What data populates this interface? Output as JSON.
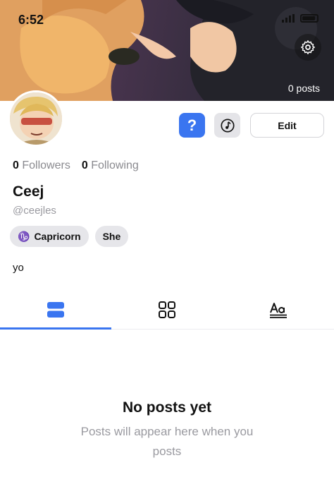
{
  "status_bar": {
    "time": "6:52"
  },
  "banner": {
    "posts_label": "0 posts"
  },
  "actions": {
    "help_label": "?",
    "edit_label": "Edit"
  },
  "stats": {
    "followers_count": "0",
    "followers_label": "Followers",
    "following_count": "0",
    "following_label": "Following"
  },
  "profile": {
    "name": "Ceej",
    "handle": "@ceejles",
    "bio": "yo"
  },
  "chips": [
    {
      "icon": "capricorn-icon",
      "label": "Capricorn"
    },
    {
      "label": "She"
    }
  ],
  "tabs": [
    {
      "icon": "list-view-icon",
      "active": true
    },
    {
      "icon": "grid-view-icon",
      "active": false
    },
    {
      "icon": "text-view-icon",
      "active": false
    }
  ],
  "empty_state": {
    "title": "No posts yet",
    "subtitle": "Posts will appear here when you posts"
  },
  "colors": {
    "accent": "#3a75f0",
    "muted": "#9a9aa0",
    "chip_bg": "#e6e6ea"
  }
}
